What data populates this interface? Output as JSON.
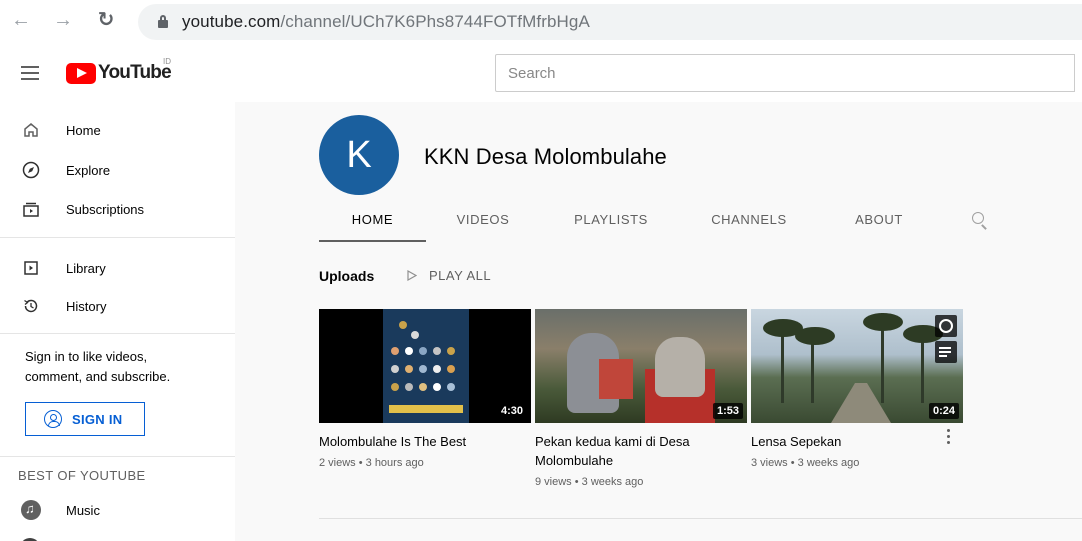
{
  "browser": {
    "url_host": "youtube.com",
    "url_path": "/channel/UCh7K6Phs8744FOTfMfrbHgA"
  },
  "header": {
    "logo_text": "YouTube",
    "logo_sup": "ID",
    "search_placeholder": "Search"
  },
  "sidebar": {
    "items": [
      {
        "label": "Home",
        "icon": "home-icon"
      },
      {
        "label": "Explore",
        "icon": "compass-icon"
      },
      {
        "label": "Subscriptions",
        "icon": "subscriptions-icon"
      },
      {
        "label": "Library",
        "icon": "library-icon"
      },
      {
        "label": "History",
        "icon": "history-icon"
      }
    ],
    "signin_prompt": "Sign in to like videos, comment, and subscribe.",
    "signin_button": "SIGN IN",
    "section_title": "BEST OF YOUTUBE",
    "best_items": [
      {
        "label": "Music",
        "icon": "music-icon"
      }
    ]
  },
  "channel": {
    "avatar_letter": "K",
    "avatar_color": "#1a5f9e",
    "name": "KKN Desa Molombulahe",
    "tabs": [
      "HOME",
      "VIDEOS",
      "PLAYLISTS",
      "CHANNELS",
      "ABOUT"
    ],
    "active_tab": "HOME"
  },
  "uploads": {
    "title": "Uploads",
    "play_all": "PLAY ALL",
    "videos": [
      {
        "title": "Molombulahe Is The Best",
        "meta": "2 views • 3 hours ago",
        "duration": "4:30"
      },
      {
        "title": "Pekan kedua kami di Desa Molombulahe",
        "meta": "9 views • 3 weeks ago",
        "duration": "1:53"
      },
      {
        "title": "Lensa Sepekan",
        "meta": "3 views • 3 weeks ago",
        "duration": "0:24"
      }
    ]
  }
}
